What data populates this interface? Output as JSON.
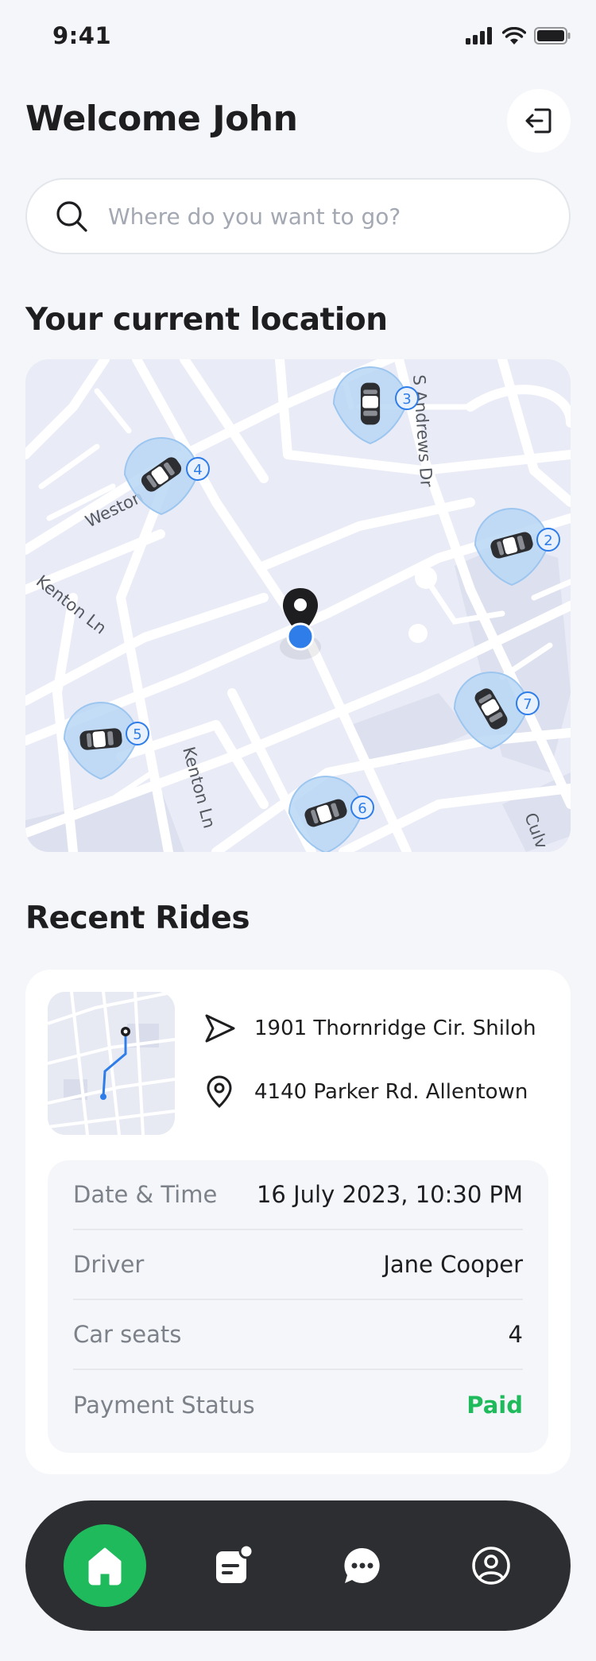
{
  "status_bar": {
    "time": "9:41"
  },
  "header": {
    "welcome": "Welcome John"
  },
  "search": {
    "placeholder": "Where do you want to go?"
  },
  "location": {
    "title": "Your current location",
    "street_labels": [
      "Weston",
      "Kenton Ln",
      "Kenton Ln",
      "S Andrews Dr",
      "Culv"
    ],
    "cars": [
      {
        "number": "2"
      },
      {
        "number": "3"
      },
      {
        "number": "4"
      },
      {
        "number": "5"
      },
      {
        "number": "6"
      },
      {
        "number": "7"
      }
    ]
  },
  "recent_rides": {
    "title": "Recent Rides",
    "ride": {
      "from": "1901 Thornridge Cir. Shiloh",
      "to": "4140 Parker Rd. Allentown",
      "details": [
        {
          "label": "Date & Time",
          "value": "16 July 2023, 10:30 PM"
        },
        {
          "label": "Driver",
          "value": "Jane Cooper"
        },
        {
          "label": "Car seats",
          "value": "4"
        },
        {
          "label": "Payment Status",
          "value": "Paid",
          "status_color": "#1fba5c"
        }
      ]
    }
  },
  "nav": {
    "items": [
      {
        "icon": "home-icon",
        "active": true
      },
      {
        "icon": "rides-icon",
        "active": false
      },
      {
        "icon": "chat-icon",
        "active": false
      },
      {
        "icon": "profile-icon",
        "active": false
      }
    ]
  },
  "colors": {
    "accent": "#1fba5c",
    "nav_bg": "#2d2e31",
    "map_bg": "#e9ebf6",
    "user_dot": "#2f7de8"
  }
}
